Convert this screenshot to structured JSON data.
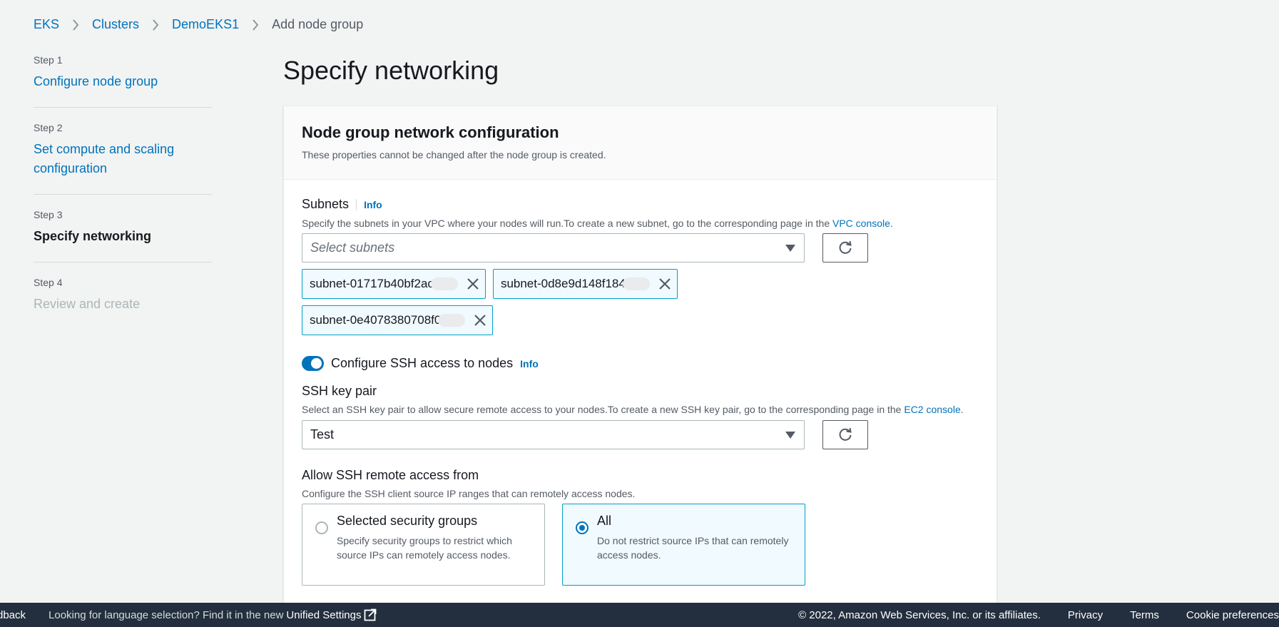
{
  "breadcrumb": [
    {
      "label": "EKS"
    },
    {
      "label": "Clusters"
    },
    {
      "label": "DemoEKS1"
    },
    {
      "label": "Add node group"
    }
  ],
  "steps": [
    {
      "num": "Step 1",
      "title": "Configure node group",
      "state": "link"
    },
    {
      "num": "Step 2",
      "title": "Set compute and scaling configuration",
      "state": "link"
    },
    {
      "num": "Step 3",
      "title": "Specify networking",
      "state": "active"
    },
    {
      "num": "Step 4",
      "title": "Review and create",
      "state": "disabled"
    }
  ],
  "page_title": "Specify networking",
  "panel": {
    "title": "Node group network configuration",
    "description": "These properties cannot be changed after the node group is created."
  },
  "subnets": {
    "label": "Subnets",
    "info": "Info",
    "description_prefix": "Specify the subnets in your VPC where your nodes will run.To create a new subnet, go to the corresponding page in the ",
    "description_link": "VPC console",
    "description_suffix": ".",
    "placeholder": "Select subnets",
    "tokens": [
      "subnet-01717b40bf2ac",
      "subnet-0d8e9d148f184",
      "subnet-0e4078380708f0"
    ]
  },
  "ssh_toggle": {
    "label": "Configure SSH access to nodes",
    "info": "Info",
    "enabled": true
  },
  "ssh_key": {
    "label": "SSH key pair",
    "description_prefix": "Select an SSH key pair to allow secure remote access to your nodes.To create a new SSH key pair, go to the corresponding page in the ",
    "description_link": "EC2 console",
    "description_suffix": ".",
    "value": "Test"
  },
  "ssh_access": {
    "label": "Allow SSH remote access from",
    "description": "Configure the SSH client source IP ranges that can remotely access nodes.",
    "options": [
      {
        "title": "Selected security groups",
        "description": "Specify security groups to restrict which source IPs can remotely access nodes.",
        "selected": false
      },
      {
        "title": "All",
        "description": "Do not restrict source IPs that can remotely access nodes.",
        "selected": true
      }
    ]
  },
  "footer": {
    "feedback": "dback",
    "lang_text": "Looking for language selection? Find it in the new",
    "unified_settings": "Unified Settings",
    "copyright": "© 2022, Amazon Web Services, Inc. or its affiliates.",
    "privacy": "Privacy",
    "terms": "Terms",
    "cookie": "Cookie preferences"
  },
  "colors": {
    "link": "#0073bb",
    "footer_bg": "#232f3e",
    "selected_border": "#00a1c9",
    "selected_bg": "#f1faff"
  }
}
